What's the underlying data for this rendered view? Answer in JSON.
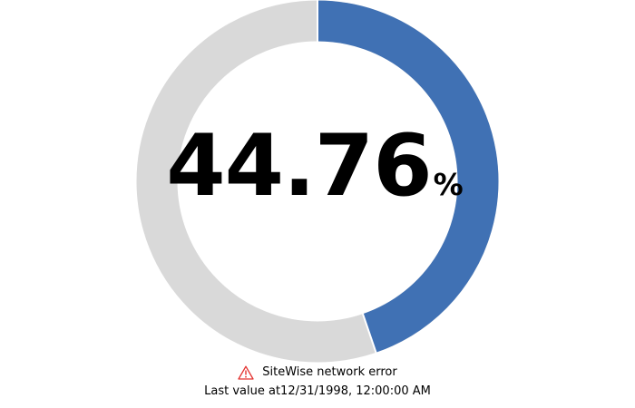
{
  "kpi": {
    "value": "44.76",
    "unit": "%",
    "percent": 44.76,
    "fill_color": "#4071b4",
    "track_color": "#d9d9d9"
  },
  "status": {
    "icon": "warning-icon",
    "icon_color": "#e3312f",
    "error_message": "SiteWise network error",
    "last_value_label": "Last value at",
    "timestamp": "12/31/1998, 12:00:00 AM"
  }
}
